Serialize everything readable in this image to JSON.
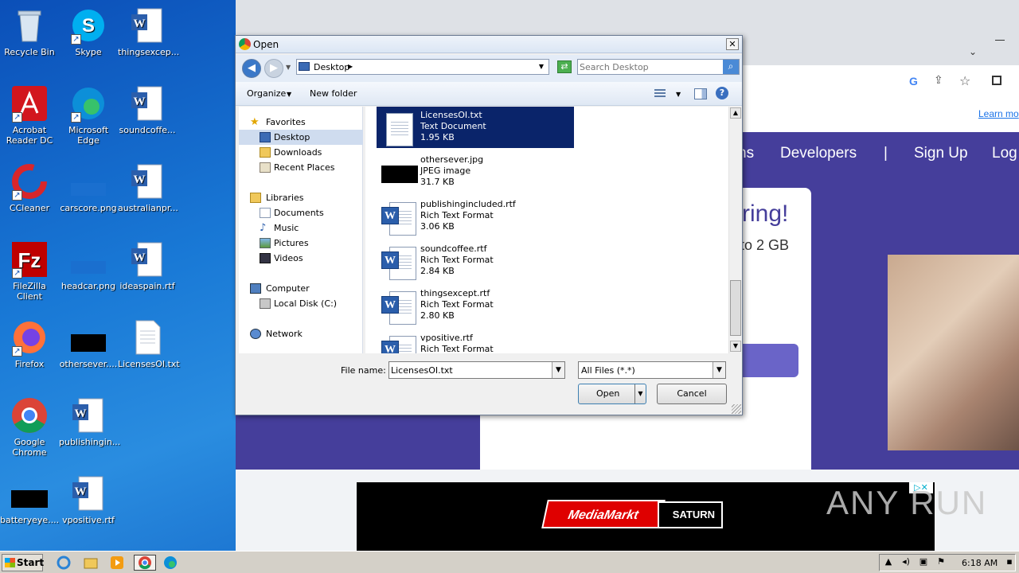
{
  "desktop_icons": [
    {
      "label": "Recycle Bin",
      "icon": "recycle-bin-icon"
    },
    {
      "label": "Skype",
      "icon": "skype-icon"
    },
    {
      "label": "thingsexcep...",
      "icon": "word-doc-icon"
    },
    {
      "label": "Acrobat Reader DC",
      "icon": "acrobat-icon"
    },
    {
      "label": "Microsoft Edge",
      "icon": "edge-icon"
    },
    {
      "label": "soundcoffe...",
      "icon": "word-doc-icon"
    },
    {
      "label": "CCleaner",
      "icon": "ccleaner-icon"
    },
    {
      "label": "carscore.png",
      "icon": "image-icon"
    },
    {
      "label": "australianpr...",
      "icon": "word-doc-icon"
    },
    {
      "label": "FileZilla Client",
      "icon": "filezilla-icon"
    },
    {
      "label": "headcar.png",
      "icon": "image-icon"
    },
    {
      "label": "ideaspain.rtf",
      "icon": "word-doc-icon"
    },
    {
      "label": "Firefox",
      "icon": "firefox-icon"
    },
    {
      "label": "othersever....",
      "icon": "image-icon"
    },
    {
      "label": "LicensesOI.txt",
      "icon": "text-doc-icon"
    },
    {
      "label": "Google Chrome",
      "icon": "chrome-icon"
    },
    {
      "label": "publishingin...",
      "icon": "word-doc-icon"
    },
    {
      "label": "batteryeye....",
      "icon": "image-icon"
    },
    {
      "label": "vpositive.rtf",
      "icon": "word-doc-icon"
    }
  ],
  "browser": {
    "nav_links": [
      "ns",
      "Developers",
      "|",
      "Sign Up",
      "Log"
    ],
    "learn_more": "Learn mo",
    "card_title": "ring!",
    "card_subtitle": "to 2 GB"
  },
  "ad": {
    "brand1": "MediaMarkt",
    "brand2": "SATURN",
    "watermark": "ANY RUN"
  },
  "dialog": {
    "title": "Open",
    "close_label": "✕",
    "address": "Desktop",
    "search_placeholder": "Search Desktop",
    "organize_label": "Organize",
    "new_folder_label": "New folder",
    "nav": {
      "favorites": "Favorites",
      "desktop": "Desktop",
      "downloads": "Downloads",
      "recent_places": "Recent Places",
      "libraries": "Libraries",
      "documents": "Documents",
      "music": "Music",
      "pictures": "Pictures",
      "videos": "Videos",
      "computer": "Computer",
      "local_disk": "Local Disk (C:)",
      "network": "Network"
    },
    "files": [
      {
        "name": "LicensesOI.txt",
        "type": "Text Document",
        "size": "1.95 KB",
        "selected": true
      },
      {
        "name": "othersever.jpg",
        "type": "JPEG image",
        "size": "31.7 KB"
      },
      {
        "name": "publishingincluded.rtf",
        "type": "Rich Text Format",
        "size": "3.06 KB"
      },
      {
        "name": "soundcoffee.rtf",
        "type": "Rich Text Format",
        "size": "2.84 KB"
      },
      {
        "name": "thingsexcept.rtf",
        "type": "Rich Text Format",
        "size": "2.80 KB"
      },
      {
        "name": "vpositive.rtf",
        "type": "Rich Text Format",
        "size": ""
      }
    ],
    "filename_label": "File name:",
    "filename_value": "LicensesOI.txt",
    "filetype_value": "All Files (*.*)",
    "open_label": "Open",
    "cancel_label": "Cancel"
  },
  "taskbar": {
    "start_label": "Start",
    "clock": "6:18 AM"
  },
  "colors": {
    "selection": "#0a246a",
    "site_purple": "#453e9b",
    "desktop_blue": "#1979d6"
  }
}
